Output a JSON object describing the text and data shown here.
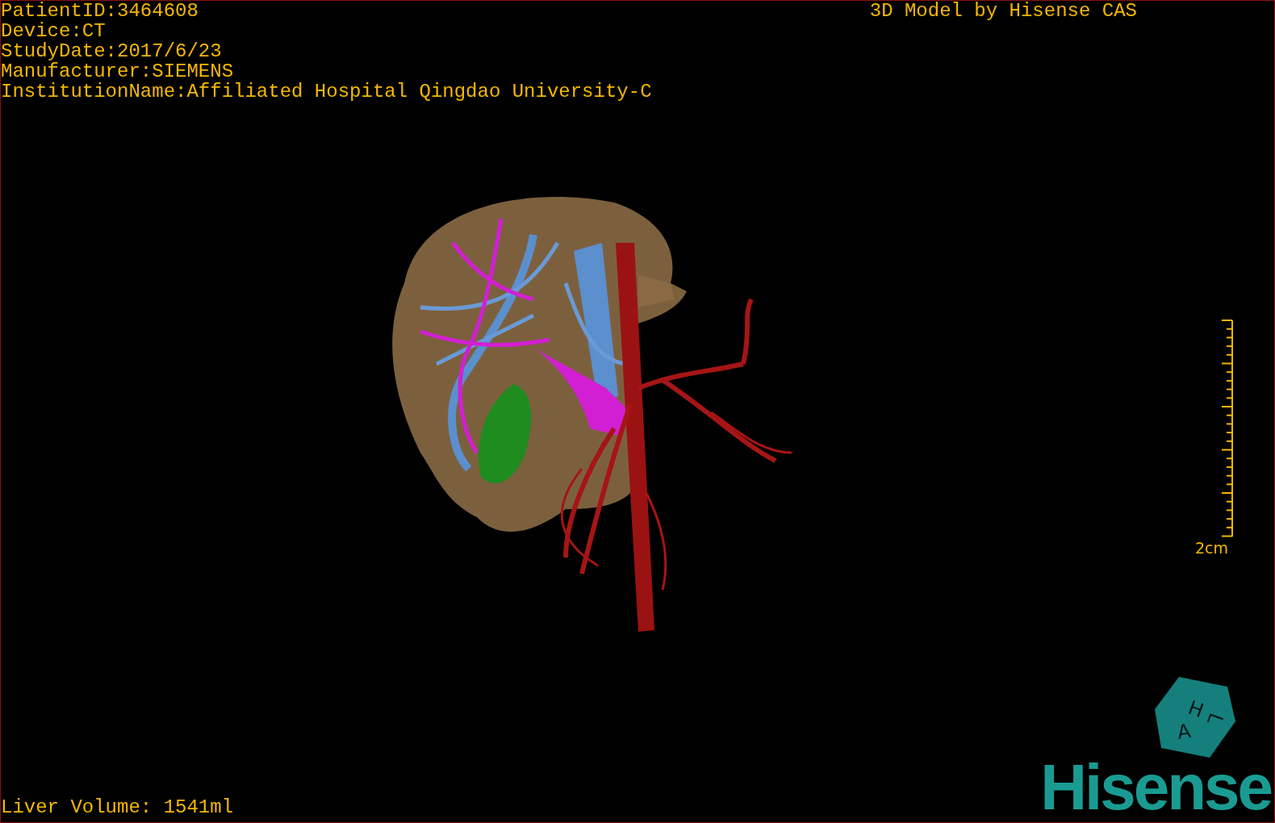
{
  "info_lines": [
    "PatientID:3464608",
    "Device:CT",
    "StudyDate:2017/6/23",
    "Manufacturer:SIEMENS",
    "InstitutionName:Affiliated Hospital Qingdao University-C"
  ],
  "title": "3D Model by Hisense CAS",
  "scale_bar": {
    "label": "2cm"
  },
  "orientation_cube": {
    "labels": [
      "H",
      "A",
      "L"
    ]
  },
  "volume": "Liver Volume: 1541ml",
  "logo": "Hisense"
}
